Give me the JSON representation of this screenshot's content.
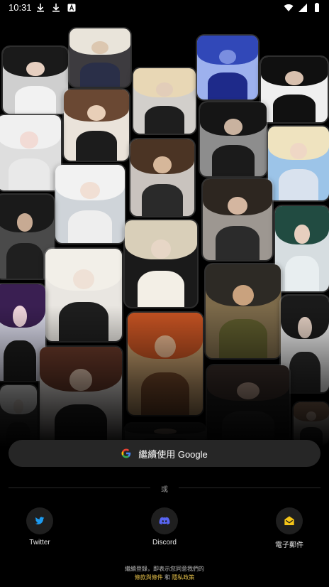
{
  "status_bar": {
    "time": "10:31",
    "left_icons": [
      "download-icon",
      "download-icon",
      "text-icon"
    ],
    "right_icons": [
      "wifi-icon",
      "signal-icon",
      "battery-icon"
    ]
  },
  "collage": {
    "tiles": [
      {
        "hair": "#1a1a1a",
        "skin": "#e6cfc0",
        "cloth": "#f2f2f2",
        "bg": "#cfcfcf"
      },
      {
        "hair": "#e9e4da",
        "skin": "#dcc7b0",
        "cloth": "#2a2f48",
        "bg": "#3d3b3f"
      },
      {
        "hair": "#6a4833",
        "skin": "#e8cfb8",
        "cloth": "#1c1c1c",
        "bg": "#eae3da"
      },
      {
        "hair": "#e8d7b5",
        "skin": "#e2cdb9",
        "cloth": "#1e1e1e",
        "bg": "#d2cfcb"
      },
      {
        "hair": "#3148b8",
        "skin": "#7a8ee0",
        "cloth": "#1e2a8a",
        "bg": "#9db1ee"
      },
      {
        "hair": "#101010",
        "skin": "#d8c0ae",
        "cloth": "#111111",
        "bg": "#efefef"
      },
      {
        "hair": "#f0f0f0",
        "skin": "#f2dbd5",
        "cloth": "#e9e9e9",
        "bg": "#dedede"
      },
      {
        "hair": "#4b3424",
        "skin": "#d6b79a",
        "cloth": "#2a2a2a",
        "bg": "#c9c3be"
      },
      {
        "hair": "#151515",
        "skin": "#c9b29f",
        "cloth": "#1b1b1b",
        "bg": "#8d8d8d"
      },
      {
        "hair": "#efe3bf",
        "skin": "#efd7c5",
        "cloth": "#d9e2ee",
        "bg": "#9cc4e8"
      },
      {
        "hair": "#f2f2f2",
        "skin": "#f1dfd4",
        "cloth": "#eeeeee",
        "bg": "#cfd4d9"
      },
      {
        "hair": "#2d2620",
        "skin": "#d4b6a0",
        "cloth": "#2b2b2b",
        "bg": "#9d9791"
      },
      {
        "hair": "#1a1a1a",
        "skin": "#c7aa93",
        "cloth": "#1f1f1f",
        "bg": "#4a4a4a"
      },
      {
        "hair": "#214b41",
        "skin": "#e7cfbf",
        "cloth": "#e8eef0",
        "bg": "#d6dde0"
      },
      {
        "hair": "#f2efe8",
        "skin": "#efe1d6",
        "cloth": "#1e1e1e",
        "bg": "#e9e6e1"
      },
      {
        "hair": "#d9cfb9",
        "skin": "#e7d6c6",
        "cloth": "#f3efe6",
        "bg": "#1a1a1a"
      },
      {
        "hair": "#2d2a25",
        "skin": "#c9a27e",
        "cloth": "#5c5a2c",
        "bg": "#7c6a4a"
      },
      {
        "hair": "#3a1f52",
        "skin": "#f0d6dd",
        "cloth": "#1b1b1b",
        "bg": "#d8d8e8"
      },
      {
        "hair": "#c85423",
        "skin": "#e6b58e",
        "cloth": "#7a4b2c",
        "bg": "#caa270"
      },
      {
        "hair": "#1a1a1a",
        "skin": "#e6d2c5",
        "cloth": "#2b2b2b",
        "bg": "#e9e9e9"
      },
      {
        "hair": "#6b3a2a",
        "skin": "#e8c9b3",
        "cloth": "#222222",
        "bg": "#e3dedb"
      },
      {
        "hair": "#d7d7d7",
        "skin": "#cfc6bf",
        "cloth": "#2a2a2a",
        "bg": "#3a3a3a"
      },
      {
        "hair": "#3a2e2a",
        "skin": "#b5998a",
        "cloth": "#2c2c2c",
        "bg": "#1c1c1c"
      },
      {
        "hair": "#8a6a55",
        "skin": "#d8bfae",
        "cloth": "#3a3a3a",
        "bg": "#bdb6b0"
      },
      {
        "hair": "#2b2b2b",
        "skin": "#b89e8c",
        "cloth": "#2b2b2b",
        "bg": "#555555"
      },
      {
        "hair": "#4a3a4a",
        "skin": "#d2b9b2",
        "cloth": "#3a3a4a",
        "bg": "#2a2a2a"
      },
      {
        "hair": "#eaeaea",
        "skin": "#f1e6df",
        "cloth": "#e6e6e6",
        "bg": "#e0e0e0"
      }
    ]
  },
  "login": {
    "google_label": "繼續使用 Google",
    "divider_text": "或",
    "twitter_label": "Twitter",
    "discord_label": "Discord",
    "email_label": "電子郵件"
  },
  "footer": {
    "line1": "繼續登錄，即表示您同意我們的",
    "terms": "條款與條件",
    "and": "和",
    "privacy": "隱私政策"
  },
  "colors": {
    "background": "#000000",
    "button_bg": "#262626",
    "twitter_blue": "#1d9bf0",
    "discord_blurple": "#5865f2",
    "email_yellow": "#f5c518",
    "link_yellow": "#e7c24a"
  }
}
